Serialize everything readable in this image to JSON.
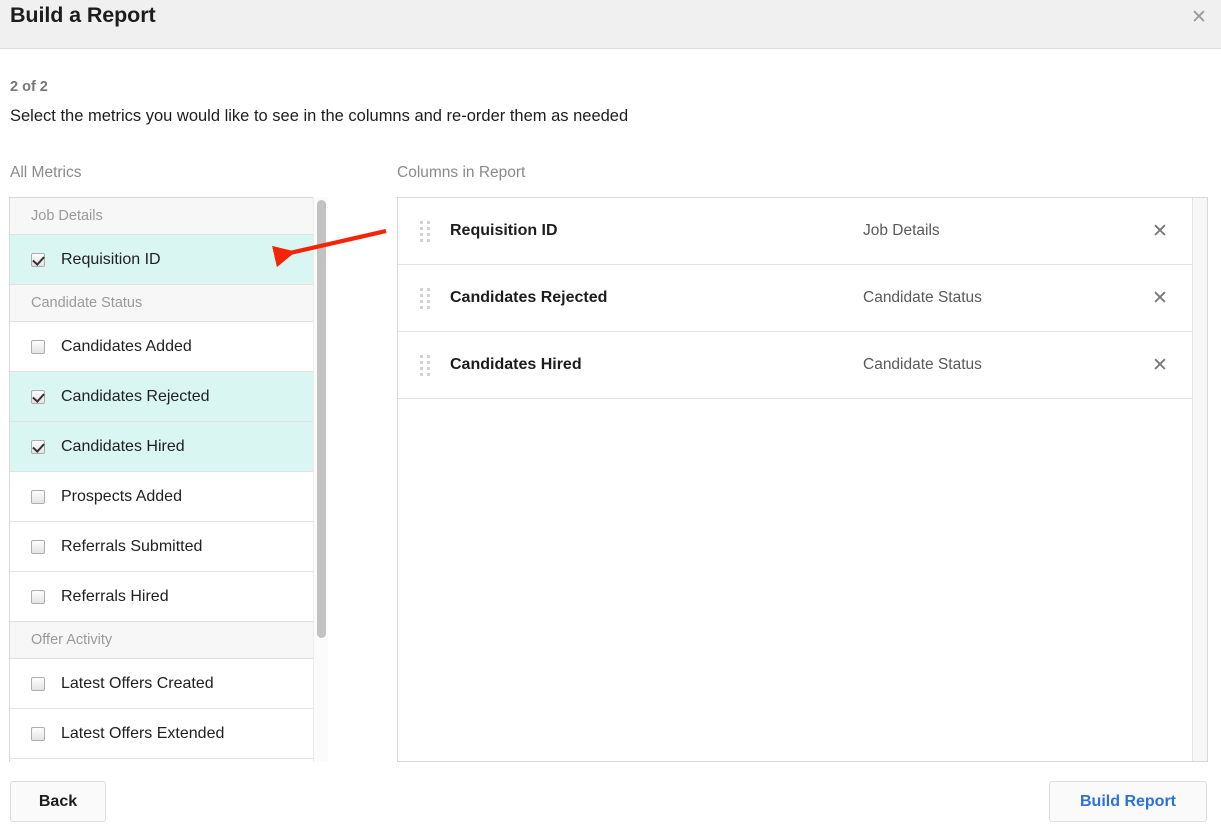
{
  "header": {
    "title": "Build a Report",
    "close_label": "✕"
  },
  "wizard": {
    "step": "2 of 2",
    "instructions": "Select the metrics you would like to see in the columns and re-order them as needed"
  },
  "panels": {
    "all_metrics_label": "All Metrics",
    "columns_in_report_label": "Columns in Report"
  },
  "all_metrics": [
    {
      "kind": "group",
      "label": "Job Details"
    },
    {
      "kind": "metric",
      "label": "Requisition ID",
      "checked": true
    },
    {
      "kind": "group",
      "label": "Candidate Status"
    },
    {
      "kind": "metric",
      "label": "Candidates Added",
      "checked": false
    },
    {
      "kind": "metric",
      "label": "Candidates Rejected",
      "checked": true
    },
    {
      "kind": "metric",
      "label": "Candidates Hired",
      "checked": true
    },
    {
      "kind": "metric",
      "label": "Prospects Added",
      "checked": false
    },
    {
      "kind": "metric",
      "label": "Referrals Submitted",
      "checked": false
    },
    {
      "kind": "metric",
      "label": "Referrals Hired",
      "checked": false
    },
    {
      "kind": "group",
      "label": "Offer Activity"
    },
    {
      "kind": "metric",
      "label": "Latest Offers Created",
      "checked": false
    },
    {
      "kind": "metric",
      "label": "Latest Offers Extended",
      "checked": false
    }
  ],
  "columns_in_report": [
    {
      "name": "Requisition ID",
      "category": "Job Details",
      "remove_label": "✕"
    },
    {
      "name": "Candidates Rejected",
      "category": "Candidate Status",
      "remove_label": "✕"
    },
    {
      "name": "Candidates Hired",
      "category": "Candidate Status",
      "remove_label": "✕"
    }
  ],
  "footer": {
    "back_label": "Back",
    "build_label": "Build Report"
  },
  "colors": {
    "selected_row": "#d9f6f2",
    "header_band": "#f0f0f0",
    "primary_action_text": "#2b71d8",
    "annotation_arrow": "#f42407",
    "scrollbar_thumb": "#c2c2c2"
  }
}
